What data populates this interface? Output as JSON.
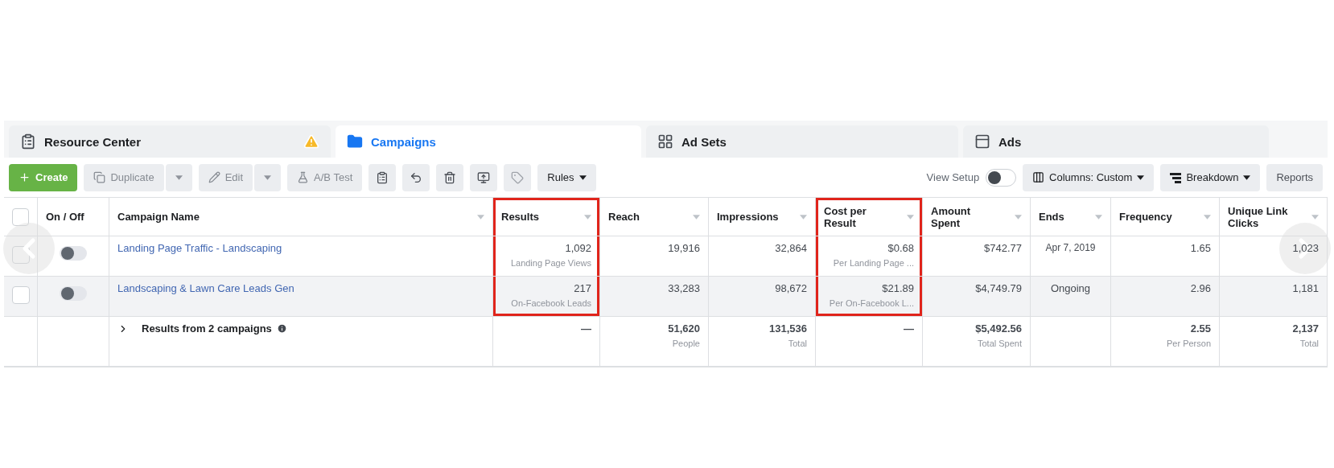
{
  "tabs": [
    {
      "label": "Resource Center",
      "selected": false,
      "alert": true
    },
    {
      "label": "Campaigns",
      "selected": true,
      "alert": false
    },
    {
      "label": "Ad Sets",
      "selected": false,
      "alert": false
    },
    {
      "label": "Ads",
      "selected": false,
      "alert": false
    }
  ],
  "toolbar": {
    "left": [
      {
        "kind": "primary",
        "label": "Create"
      },
      {
        "kind": "split",
        "label": "Duplicate",
        "disabled": true
      },
      {
        "kind": "split",
        "label": "Edit",
        "disabled": true
      },
      {
        "kind": "button",
        "label": "A/B Test",
        "disabled": true
      },
      {
        "kind": "icon",
        "disabled": false
      },
      {
        "kind": "icon",
        "disabled": false
      },
      {
        "kind": "icon",
        "disabled": false
      },
      {
        "kind": "icon",
        "disabled": false
      },
      {
        "kind": "icon",
        "disabled": true
      },
      {
        "kind": "menu",
        "label": "Rules",
        "disabled": false
      }
    ],
    "view_setup": {
      "label": "View Setup",
      "on": false
    },
    "right": [
      {
        "kind": "menu",
        "label": "Columns: Custom",
        "disabled": false
      },
      {
        "kind": "menu",
        "label": "Breakdown",
        "disabled": false
      },
      {
        "kind": "button",
        "label": "Reports",
        "disabled": false
      }
    ]
  },
  "table": {
    "select_all": {
      "checked": false
    },
    "fixed_columns": [
      {
        "label": "On / Off"
      },
      {
        "label": "Campaign Name",
        "sortable": true
      }
    ],
    "columns": [
      {
        "kind": "num",
        "label": "Results",
        "highlighted": true,
        "sortable": true
      },
      {
        "kind": "num",
        "label": "Reach",
        "highlighted": false,
        "sortable": true
      },
      {
        "kind": "num",
        "label": "Impressions",
        "highlighted": false,
        "sortable": true
      },
      {
        "kind": "num",
        "label": "Cost per\nResult",
        "highlighted": true,
        "sortable": true
      },
      {
        "kind": "num",
        "label": "Amount\nSpent",
        "highlighted": false,
        "sortable": true
      },
      {
        "kind": "center",
        "label": "Ends",
        "highlighted": false,
        "sortable": true
      },
      {
        "kind": "num",
        "label": "Frequency",
        "highlighted": false,
        "sortable": true
      },
      {
        "kind": "num",
        "label": "Unique Link\nClicks",
        "highlighted": false,
        "sortable": true
      }
    ],
    "rows": [
      {
        "checked": false,
        "on": false,
        "hovered": false,
        "name": "Landing Page Traffic - Landscaping",
        "cells": [
          {
            "value": "1,092",
            "sub": "Landing Page Views"
          },
          {
            "value": "19,916"
          },
          {
            "value": "32,864"
          },
          {
            "value": "$0.68",
            "sub": "Per Landing Page ..."
          },
          {
            "value": "$742.77"
          },
          {
            "value": "Apr 7, 2019",
            "small": true
          },
          {
            "value": "1.65"
          },
          {
            "value": "1,023"
          }
        ]
      },
      {
        "checked": false,
        "on": false,
        "hovered": true,
        "name": "Landscaping & Lawn Care Leads Gen",
        "cells": [
          {
            "value": "217",
            "sub": "On-Facebook Leads"
          },
          {
            "value": "33,283"
          },
          {
            "value": "98,672"
          },
          {
            "value": "$21.89",
            "sub": "Per On-Facebook L..."
          },
          {
            "value": "$4,749.79"
          },
          {
            "value": "Ongoing"
          },
          {
            "value": "2.96"
          },
          {
            "value": "1,181"
          }
        ]
      }
    ],
    "total": {
      "label": "Results from 2 campaigns",
      "cells": [
        {
          "value": "—"
        },
        {
          "value": "51,620",
          "sub": "People"
        },
        {
          "value": "131,536",
          "sub": "Total"
        },
        {
          "value": "—"
        },
        {
          "value": "$5,492.56",
          "sub": "Total Spent"
        },
        {},
        {
          "value": "2.55",
          "sub": "Per Person"
        },
        {
          "value": "2,137",
          "sub": "Total"
        }
      ]
    }
  }
}
